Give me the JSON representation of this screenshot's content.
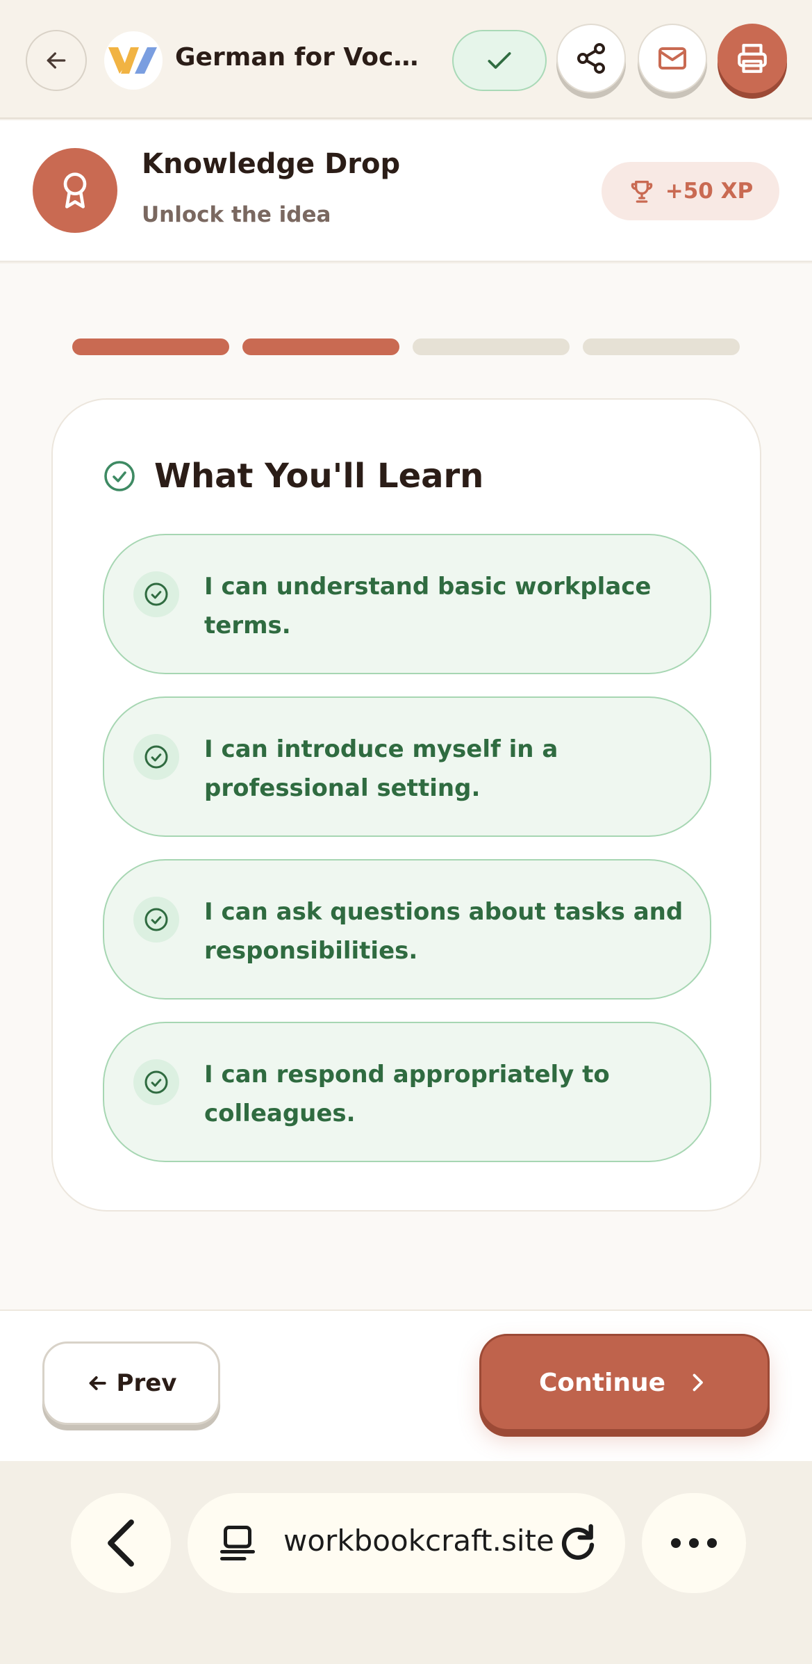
{
  "header": {
    "title": "German for Vocational Purposes",
    "icons": {
      "back": "arrow-left-icon",
      "logo": "app-logo",
      "done": "check-icon",
      "share": "share-icon",
      "mail": "mail-icon",
      "print": "printer-icon"
    }
  },
  "section": {
    "title": "Knowledge Drop",
    "subtitle": "Unlock the idea",
    "badge_icon": "award-ribbon-icon",
    "xp_label": "+50 XP",
    "xp_icon": "trophy-icon"
  },
  "progress": {
    "total_steps": 4,
    "completed_steps": 2
  },
  "card": {
    "title": "What You'll Learn",
    "objectives": [
      "I can understand basic workplace terms.",
      "I can introduce myself in a professional setting.",
      "I can ask questions about tasks and responsibilities.",
      "I can respond appropriately to colleagues."
    ]
  },
  "nav": {
    "prev_label": "Prev",
    "continue_label": "Continue"
  },
  "browser": {
    "url": "workbookcraft.site",
    "icons": {
      "back": "chevron-left-icon",
      "tab": "tab-icon",
      "reload": "reload-icon",
      "more": "more-dots-icon"
    }
  },
  "colors": {
    "accent": "#c96a52",
    "success_text": "#2f6b40",
    "success_bg": "#eff7f0",
    "success_border": "#a6d6b2",
    "page_bg": "#f4efe8"
  }
}
